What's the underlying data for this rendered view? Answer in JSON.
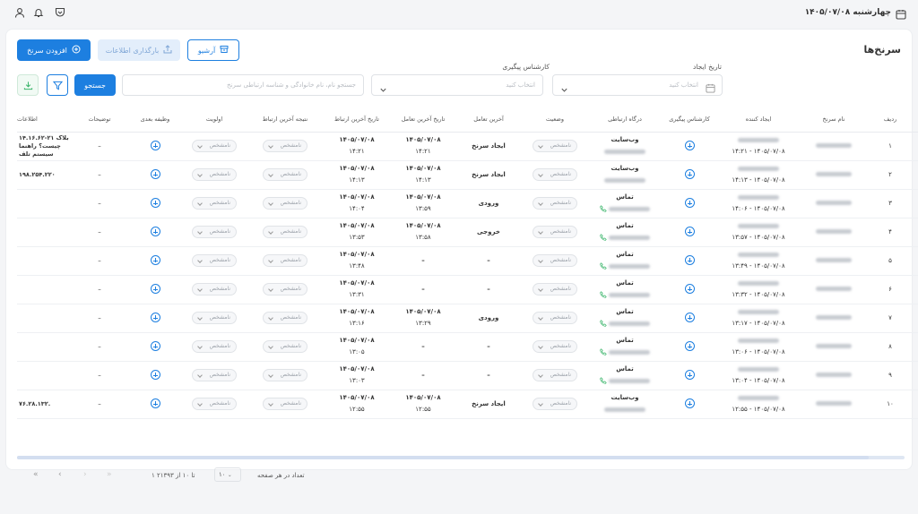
{
  "header": {
    "date": "چهارشنبه ۱۴۰۵/۰۷/۰۸"
  },
  "page": {
    "title": "سرنخ‌ها",
    "add_button": "افزودن سرنخ",
    "upload_button": "بارگذاری اطلاعات",
    "archive_button": "آرشیو",
    "search_button": "جستجو"
  },
  "filters": {
    "created_date_label": "تاریخ ایجاد",
    "created_date_placeholder": "انتخاب کنید",
    "expert_label": "کارشناس پیگیری",
    "expert_placeholder": "انتخاب کنید",
    "search_placeholder": "جستجو نام، نام خانوادگی و شناسه ارتباطی سرنخ"
  },
  "table": {
    "headers": [
      "ردیف",
      "نام سرنخ",
      "ایجاد کننده",
      "کارشناس پیگیری",
      "درگاه ارتباطی",
      "وضعیت",
      "آخرین تعامل",
      "تاریخ آخرین تعامل",
      "تاریخ آخرین ارتباط",
      "نتیجه آخرین ارتباط",
      "اولویت",
      "وظیفه بعدی",
      "توضیحات",
      "اطلاعات"
    ],
    "unknown": "نامشخص",
    "dash": "–",
    "rows": [
      {
        "index": "۱",
        "time": "۱۴۰۵/۰۷/۰۸ - ۱۴:۲۱",
        "channel": "وب‌سایت",
        "last_interaction": "ایجاد سرنخ",
        "interaction_date": "۱۴۰۵/۰۷/۰۸",
        "interaction_time": "۱۴:۲۱",
        "contact_date": "۱۴۰۵/۰۷/۰۸",
        "contact_time": "۱۴:۲۱",
        "info": "بلاک ۲۱-۱۴.۱۶.۶۲ چیست؟ راهنما سیستم تلف"
      },
      {
        "index": "۲",
        "time": "۱۴۰۵/۰۷/۰۸ - ۱۴:۱۳",
        "channel": "وب‌سایت",
        "last_interaction": "ایجاد سرنخ",
        "interaction_date": "۱۴۰۵/۰۷/۰۸",
        "interaction_time": "۱۴:۱۳",
        "contact_date": "۱۴۰۵/۰۷/۰۸",
        "contact_time": "۱۴:۱۳",
        "info": "۱۹۸.۲۵۴.۲۲۰"
      },
      {
        "index": "۳",
        "time": "۱۴۰۵/۰۷/۰۸ - ۱۴:۰۶",
        "channel": "تماس",
        "last_interaction": "ورودی",
        "interaction_date": "۱۴۰۵/۰۷/۰۸",
        "interaction_time": "۱۳:۵۹",
        "contact_date": "۱۴۰۵/۰۷/۰۸",
        "contact_time": "۱۴:۰۴",
        "info": ""
      },
      {
        "index": "۴",
        "time": "۱۴۰۵/۰۷/۰۸ - ۱۳:۵۷",
        "channel": "تماس",
        "last_interaction": "خروجی",
        "interaction_date": "۱۴۰۵/۰۷/۰۸",
        "interaction_time": "۱۳:۵۸",
        "contact_date": "۱۴۰۵/۰۷/۰۸",
        "contact_time": "۱۳:۵۳",
        "info": ""
      },
      {
        "index": "۵",
        "time": "۱۴۰۵/۰۷/۰۸ - ۱۳:۴۹",
        "channel": "تماس",
        "last_interaction": "–",
        "interaction_date": "–",
        "interaction_time": "",
        "contact_date": "۱۴۰۵/۰۷/۰۸",
        "contact_time": "۱۳:۴۸",
        "info": ""
      },
      {
        "index": "۶",
        "time": "۱۴۰۵/۰۷/۰۸ - ۱۳:۳۲",
        "channel": "تماس",
        "last_interaction": "–",
        "interaction_date": "–",
        "interaction_time": "",
        "contact_date": "۱۴۰۵/۰۷/۰۸",
        "contact_time": "۱۳:۳۱",
        "info": ""
      },
      {
        "index": "۷",
        "time": "۱۴۰۵/۰۷/۰۸ - ۱۳:۱۷",
        "channel": "تماس",
        "last_interaction": "ورودی",
        "interaction_date": "۱۴۰۵/۰۷/۰۸",
        "interaction_time": "۱۳:۲۹",
        "contact_date": "۱۴۰۵/۰۷/۰۸",
        "contact_time": "۱۳:۱۶",
        "info": ""
      },
      {
        "index": "۸",
        "time": "۱۴۰۵/۰۷/۰۸ - ۱۳:۰۶",
        "channel": "تماس",
        "last_interaction": "–",
        "interaction_date": "–",
        "interaction_time": "",
        "contact_date": "۱۴۰۵/۰۷/۰۸",
        "contact_time": "۱۳:۰۵",
        "info": ""
      },
      {
        "index": "۹",
        "time": "۱۴۰۵/۰۷/۰۸ - ۱۳:۰۴",
        "channel": "تماس",
        "last_interaction": "–",
        "interaction_date": "–",
        "interaction_time": "",
        "contact_date": "۱۴۰۵/۰۷/۰۸",
        "contact_time": "۱۳:۰۳",
        "info": ""
      },
      {
        "index": "۱۰",
        "time": "۱۴۰۵/۰۷/۰۸ - ۱۲:۵۵",
        "channel": "وب‌سایت",
        "last_interaction": "ایجاد سرنخ",
        "interaction_date": "۱۴۰۵/۰۷/۰۸",
        "interaction_time": "۱۲:۵۵",
        "contact_date": "۱۴۰۵/۰۷/۰۸",
        "contact_time": "۱۲:۵۵",
        "info": "۷۶.۲۸.۱۳۲."
      }
    ]
  },
  "pagination": {
    "per_page_label": "تعداد در هر صفحه",
    "per_page_value": "۱۰",
    "range": "۱ تا ۱۰ از ۲۱۳۹۳"
  },
  "colors": {
    "primary": "#1d7fe0",
    "success": "#3bb56b"
  },
  "icons": [
    "calendar-icon",
    "user-icon",
    "bell-icon",
    "pocket-icon",
    "add-lead-icon",
    "upload-icon",
    "archive-icon",
    "chevron-down-icon",
    "filter-icon",
    "download-icon",
    "plus-circle-icon",
    "phone-icon"
  ]
}
